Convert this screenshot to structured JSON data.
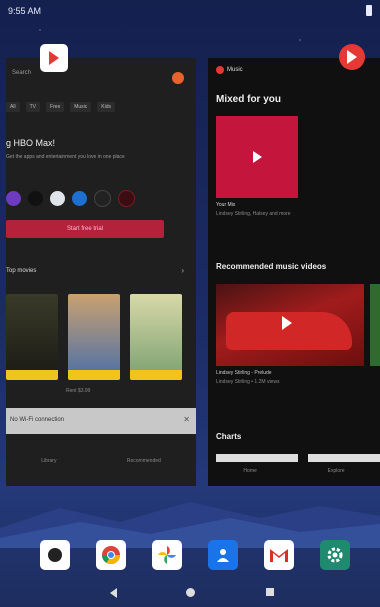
{
  "status_bar": {
    "time": "9:55 AM"
  },
  "left_app": {
    "search_placeholder": "Search",
    "chips": [
      "All",
      "TV",
      "Free",
      "Music",
      "Kids"
    ],
    "promo_title": "g HBO Max!",
    "promo_subtitle": "Get the apps and entertainment you love in one place",
    "promo_button": "Start free trial",
    "section_title": "Top movies",
    "poster_caption": "Rent $3.99",
    "download_bar_text": "No Wi-Fi connection",
    "nav": [
      "Library",
      "Recommended"
    ]
  },
  "right_app": {
    "app_name": "Music",
    "mixed_heading": "Mixed for you",
    "mix_title": "Your Mix",
    "mix_subtitle": "Lindsey Stirling, Halsey and more",
    "recommended_heading": "Recommended music videos",
    "video_title": "Lindsey Stirling - Prelude",
    "video_subtitle": "Lindsey Stirling • 1.2M views",
    "charts_heading": "Charts",
    "nav": [
      "Home",
      "Explore"
    ]
  },
  "dock": {
    "icons": [
      "camera-icon",
      "chrome-icon",
      "photos-icon",
      "contacts-icon",
      "gmail-icon",
      "settings-icon"
    ]
  },
  "colors": {
    "accent_red": "#e53935",
    "promo_red": "#b3213a",
    "wallpaper": "#1c2c66"
  }
}
